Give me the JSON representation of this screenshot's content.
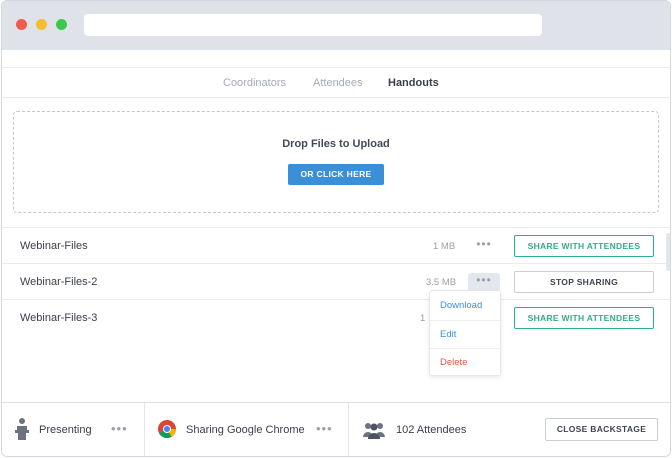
{
  "tabs": [
    "Coordinators",
    "Attendees",
    "Handouts"
  ],
  "upload": {
    "title": "Drop Files to Upload",
    "button": "OR CLICK HERE"
  },
  "files": [
    {
      "name": "Webinar-Files",
      "size": "1 MB",
      "action": "SHARE WITH ATTENDEES"
    },
    {
      "name": "Webinar-Files-2",
      "size": "3.5 MB",
      "action": "STOP SHARING"
    },
    {
      "name": "Webinar-Files-3",
      "size": "1",
      "action": "SHARE WITH ATTENDEES"
    }
  ],
  "menu": [
    "Download",
    "Edit",
    "Delete"
  ],
  "more_label": "•••",
  "footer": {
    "presenting": "Presenting",
    "sharing": "Sharing Google Chrome",
    "attendees": "102 Attendees",
    "close": "CLOSE BACKSTAGE"
  },
  "icons": {
    "presenter": "presenter-icon",
    "chrome": "chrome-icon",
    "attendees": "people-icon"
  },
  "colors": {
    "primary": "#3b8fd9",
    "share": "#2bb08a",
    "delete": "#e0544a"
  }
}
